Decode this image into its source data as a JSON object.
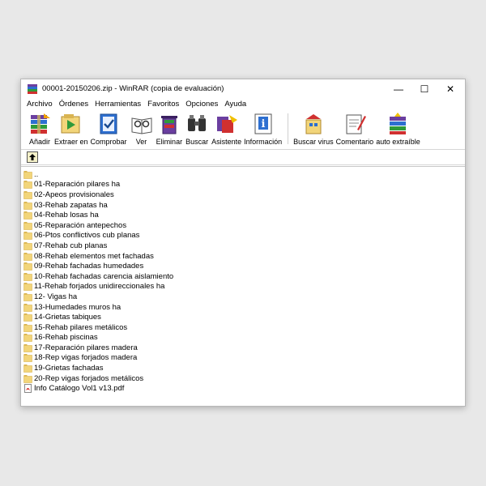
{
  "window": {
    "title": "00001-20150206.zip - WinRAR (copia de evaluación)",
    "minimize_glyph": "—",
    "maximize_glyph": "☐",
    "close_glyph": "✕"
  },
  "menu": {
    "items": [
      "Archivo",
      "Órdenes",
      "Herramientas",
      "Favoritos",
      "Opciones",
      "Ayuda"
    ]
  },
  "toolbar": {
    "buttons": [
      {
        "label": "Añadir",
        "icon": "add-archive-icon"
      },
      {
        "label": "Extraer en",
        "icon": "extract-to-icon"
      },
      {
        "label": "Comprobar",
        "icon": "test-icon"
      },
      {
        "label": "Ver",
        "icon": "view-icon"
      },
      {
        "label": "Eliminar",
        "icon": "delete-icon"
      },
      {
        "label": "Buscar",
        "icon": "find-icon"
      },
      {
        "label": "Asistente",
        "icon": "wizard-icon"
      },
      {
        "label": "Información",
        "icon": "info-icon"
      },
      {
        "label": "Buscar virus",
        "icon": "virus-scan-icon"
      },
      {
        "label": "Comentario",
        "icon": "comment-icon"
      },
      {
        "label": "auto extraíble",
        "icon": "sfx-icon"
      }
    ]
  },
  "pathbar": {
    "up_icon": "up-folder-icon"
  },
  "files": [
    {
      "name": "..",
      "type": "folder"
    },
    {
      "name": "01-Reparación pilares ha",
      "type": "folder"
    },
    {
      "name": "02-Apeos provisionales",
      "type": "folder"
    },
    {
      "name": "03-Rehab zapatas ha",
      "type": "folder"
    },
    {
      "name": "04-Rehab losas ha",
      "type": "folder"
    },
    {
      "name": "05-Reparación antepechos",
      "type": "folder"
    },
    {
      "name": "06-Ptos conflictivos cub planas",
      "type": "folder"
    },
    {
      "name": "07-Rehab cub planas",
      "type": "folder"
    },
    {
      "name": "08-Rehab elementos met fachadas",
      "type": "folder"
    },
    {
      "name": "09-Rehab fachadas humedades",
      "type": "folder"
    },
    {
      "name": "10-Rehab fachadas carencia aislamiento",
      "type": "folder"
    },
    {
      "name": "11-Rehab forjados unidireccionales ha",
      "type": "folder"
    },
    {
      "name": "12- Vigas ha",
      "type": "folder"
    },
    {
      "name": "13-Humedades muros ha",
      "type": "folder"
    },
    {
      "name": "14-Grietas tabiques",
      "type": "folder"
    },
    {
      "name": "15-Rehab pilares metálicos",
      "type": "folder"
    },
    {
      "name": "16-Rehab piscinas",
      "type": "folder"
    },
    {
      "name": "17-Reparación pilares madera",
      "type": "folder"
    },
    {
      "name": "18-Rep vigas forjados madera",
      "type": "folder"
    },
    {
      "name": "19-Grietas fachadas",
      "type": "folder"
    },
    {
      "name": "20-Rep vigas forjados metálicos",
      "type": "folder"
    },
    {
      "name": "Info Catálogo Vol1 v13.pdf",
      "type": "pdf"
    }
  ],
  "colors": {
    "folder": "#f2d57a",
    "folder_edge": "#d9b452",
    "pdf_red": "#d32020",
    "rar_stack": [
      "#6b3fa0",
      "#2d6fd0",
      "#2f9a3a",
      "#d03030"
    ]
  }
}
